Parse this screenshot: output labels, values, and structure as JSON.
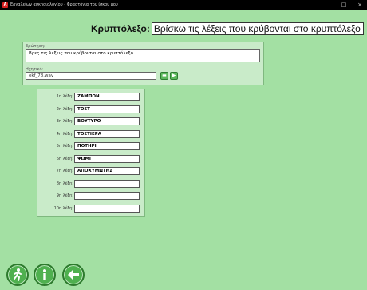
{
  "window": {
    "title": "Εργαλείων ασκησιολογίου - Φραστόγια του ίσκου μου"
  },
  "header": {
    "label": "Κρυπτόλεξο:",
    "value": "Βρίσκω τις λέξεις που κρύβονται στο κρυπτόλεξο"
  },
  "question": {
    "label": "Ερώτηση:",
    "text": "Βρες τις λέξεις που κρύβονται στο κρυπτόλεξο."
  },
  "sound": {
    "label": "Ηχητικό:",
    "file": "ekf_78.wav",
    "button_icons": [
      "folder-icon",
      "play-icon"
    ]
  },
  "words": [
    {
      "label": "1η λέξη:",
      "value": "ΖΑΜΠΟΝ"
    },
    {
      "label": "2η λέξη:",
      "value": "ΤΟΣΤ"
    },
    {
      "label": "3η λέξη:",
      "value": "ΒΟΥΤΥΡΟ"
    },
    {
      "label": "4η λέξη:",
      "value": "ΤΟΣΤΙΕΡΑ"
    },
    {
      "label": "5η λέξη:",
      "value": "ΠΟΤΗΡΙ"
    },
    {
      "label": "6η λέξη:",
      "value": "ΨΩΜΙ"
    },
    {
      "label": "7η λέξη:",
      "value": "ΑΠΟΧΥΜΩΤΗΣ"
    },
    {
      "label": "8η λέξη:",
      "value": ""
    },
    {
      "label": "9η λέξη:",
      "value": ""
    },
    {
      "label": "10η λέξη:",
      "value": ""
    }
  ],
  "footer": {
    "buttons": [
      "exit-icon",
      "info-icon",
      "back-arrow-icon"
    ]
  },
  "colors": {
    "background": "#a3e0a3",
    "panel": "#c9ebc9",
    "button_green": "#4fb04f"
  }
}
